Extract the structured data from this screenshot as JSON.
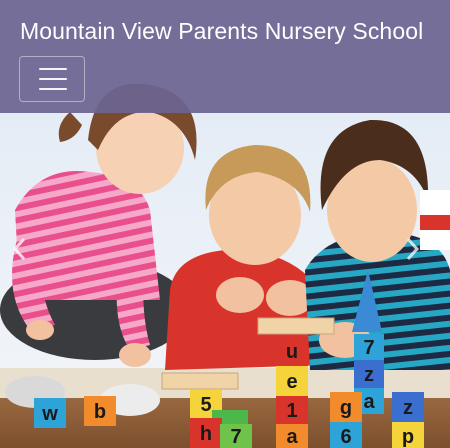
{
  "header": {
    "site_title": "Mountain View Parents Nursery School",
    "menu_icon": "hamburger-icon"
  },
  "hero": {
    "image_subject": "children-playing-with-letter-blocks",
    "prev_icon": "chevron-left-icon",
    "next_icon": "chevron-right-icon"
  },
  "blocks": {
    "front_left": "w",
    "front_mid": "b",
    "stack_left_top": "5",
    "stack_left_bottom": "h",
    "stack_mid_top": "u",
    "stack_mid_2": "e",
    "stack_mid_3": "1",
    "stack_mid_4": "a",
    "stack_right_1": "7",
    "stack_right_2": "z",
    "stack_right_3": "a",
    "stack_right_4": "6",
    "far_right_1": "z",
    "far_right_2": "p",
    "blk_green": "7",
    "orange_mid": "g"
  },
  "colors": {
    "header_bg": "#6c6491",
    "header_text": "#ffffff"
  }
}
